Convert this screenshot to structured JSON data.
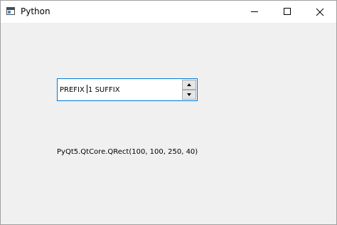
{
  "window": {
    "title": "Python",
    "icon": "python-window-icon"
  },
  "titlebar_buttons": {
    "minimize_icon": "minimize-icon",
    "maximize_icon": "maximize-icon",
    "close_icon": "close-icon"
  },
  "spinbox": {
    "prefix": "PREFIX ",
    "value": "1",
    "suffix": " SUFFIX",
    "accent_color": "#0078d7"
  },
  "geometry_label": {
    "text": "PyQt5.QtCore.QRect(100, 100, 250, 40)"
  }
}
